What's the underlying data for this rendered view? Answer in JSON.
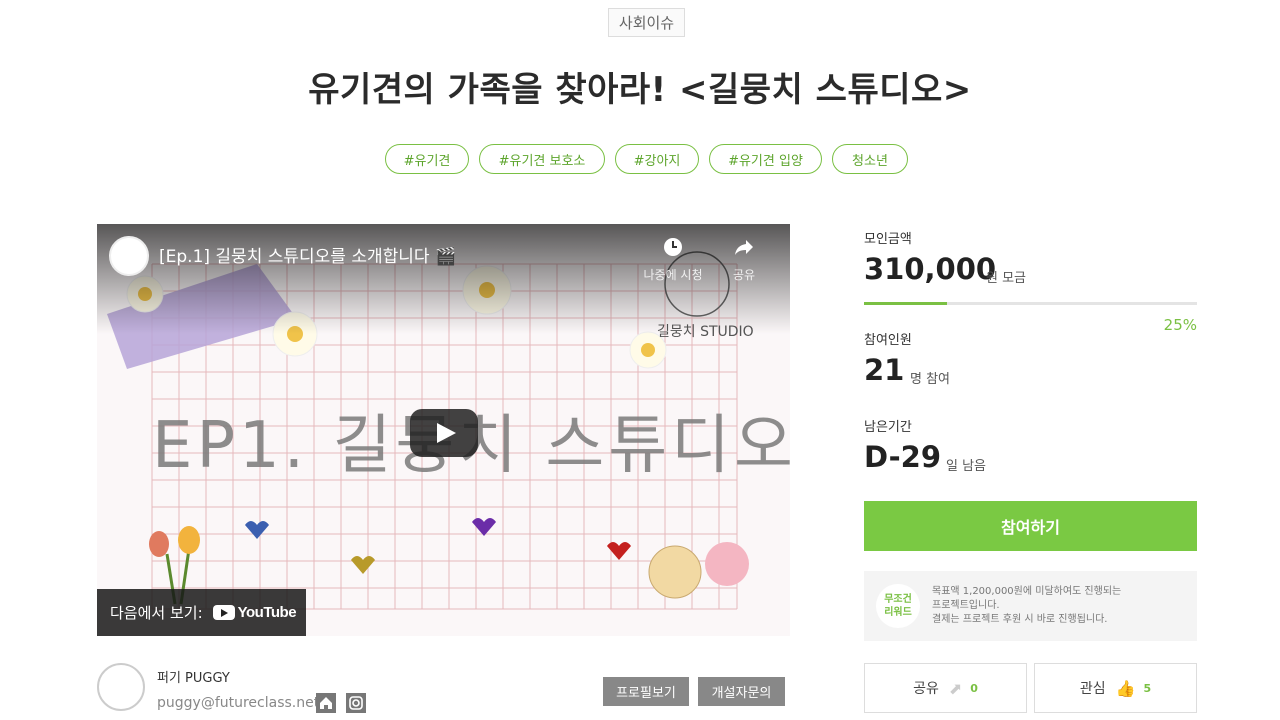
{
  "category": "사회이슈",
  "title": "유기견의 가족을 찾아라! <길뭉치 스튜디오>",
  "tags": [
    "#유기견",
    "#유기견 보호소",
    "#강아지",
    "#유기견 입양",
    "청소년"
  ],
  "video": {
    "title": "[Ep.1] 길뭉치 스튜디오를 소개합니다 🎬",
    "watch_later_label": "나중에 시청",
    "share_label": "공유",
    "overlay_text": "EP1. 길뭉치 스튜디오",
    "studio_label": "길뭉치 STUDIO",
    "watch_on_label": "다음에서 보기:",
    "youtube_label": "YouTube"
  },
  "funding": {
    "amount_label": "모인금액",
    "amount": "310,000",
    "amount_unit": "원 모금",
    "progress_percent": 25,
    "progress_text": "25%",
    "participants_label": "참여인원",
    "participants": "21",
    "participants_unit": "명 참여",
    "remaining_label": "남은기간",
    "remaining": "D-29",
    "remaining_unit": "일 남음",
    "join_label": "참여하기",
    "reward_badge_line1": "무조건",
    "reward_badge_line2": "리워드",
    "notice_line1": "목표액 1,200,000원에 미달하여도 진행되는",
    "notice_line2": "프로젝트입니다.",
    "notice_line3": "결제는 프로젝트 후원 시 바로 진행됩니다.",
    "share_label": "공유",
    "share_count": "0",
    "interest_label": "관심",
    "interest_count": "5"
  },
  "author": {
    "name": "퍼기 PUGGY",
    "email": "puggy@futureclass.net",
    "profile_button": "프로필보기",
    "contact_button": "개설자문의"
  },
  "colors": {
    "accent": "#7ac943",
    "tag_border": "#7ac043",
    "gray_button": "#888888"
  }
}
